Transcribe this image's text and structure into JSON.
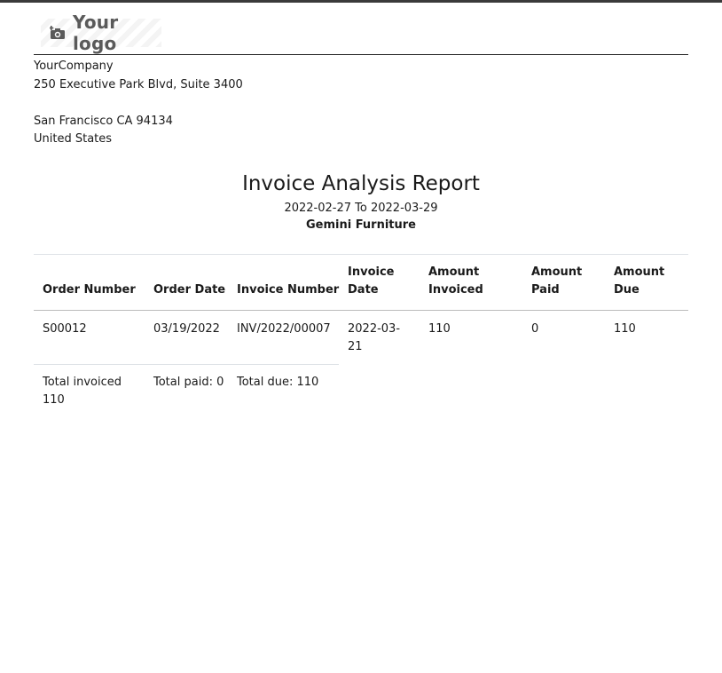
{
  "company": {
    "logo_text": "Your logo",
    "name": "YourCompany",
    "address_line1": "250 Executive Park Blvd, Suite 3400",
    "address_line2": "",
    "city_line": "San Francisco CA 94134",
    "country": "United States"
  },
  "report": {
    "title": "Invoice Analysis Report",
    "date_from": "2022-02-27",
    "date_to_word": "To",
    "date_to": "2022-03-29",
    "partner": "Gemini Furniture"
  },
  "table": {
    "headers": {
      "order_number": "Order Number",
      "order_date": "Order Date",
      "invoice_number": "Invoice Number",
      "invoice_date_1": "Invoice",
      "invoice_date_2": "Date",
      "amount_invoiced_1": "Amount",
      "amount_invoiced_2": "Invoiced",
      "amount_paid_1": "Amount",
      "amount_paid_2": "Paid",
      "amount_due_1": "Amount",
      "amount_due_2": "Due"
    },
    "rows": [
      {
        "order_number": "S00012",
        "order_date": "03/19/2022",
        "invoice_number": "INV/2022/00007",
        "invoice_date_1": "2022-03-",
        "invoice_date_2": "21",
        "amount_invoiced": "110",
        "amount_paid": "0",
        "amount_due": "110"
      }
    ],
    "totals": {
      "invoiced_label": "Total invoiced",
      "invoiced_value": "110",
      "paid": "Total paid: 0",
      "due": "Total due: 110"
    }
  },
  "colors": {
    "top_bar": "#3a3a3a",
    "logo_text": "#5a5a5a"
  },
  "icons": {
    "logo_icon": "camera-plus-icon"
  }
}
